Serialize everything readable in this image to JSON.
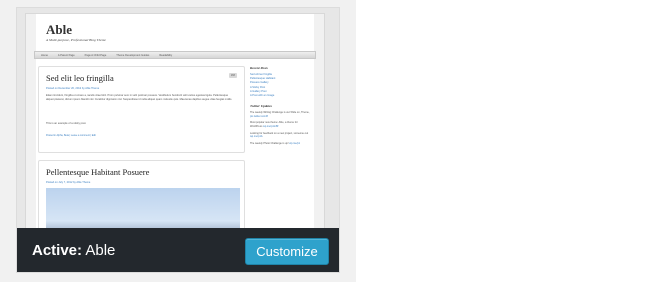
{
  "theme_preview": {
    "site_title": "Able",
    "tagline": "A Multi-purpose, Professional Blog Theme",
    "nav": [
      "Home",
      "A Parent Page",
      "Page A Child Page",
      "Theme Development Guides",
      "Readability"
    ],
    "posts": [
      {
        "title": "Sed elit leo fringilla",
        "meta": "Posted on December 20, 2012 by Able Theme",
        "badge": "###",
        "text": "Etiam tincidunt, fringilla et ornare a, iaculis vitae feliz. Proin pulvinar sem in velit pulvinar posuere. Vestibulum hendrerit velit varius egestas ligula. Pellentesque aliquet placerat, dictum ipsum blandit nisl. Curabitur dignissim nisl. Suspendisse id nulla aliquet quam molestie quis. Maecenas dapibus augue vitae feugiat mollis.",
        "text2": "This is an example of a sticky post.",
        "footer": "Posted in Alpha, Beta | Leave a comment | Edit"
      },
      {
        "title": "Pellentesque Habitant Posuere",
        "meta": "Posted on July 7, 2012 by Able Theme"
      }
    ],
    "sidebar": {
      "recent_posts_title": "Recent Posts",
      "recent_posts": [
        "Sed elit leo fringilla",
        "Pellentesque Habitant",
        "Posuere Gallery",
        "A Sticky Post",
        "A Gallery Post",
        "A Post with an Image"
      ],
      "twitter_title": "Twitter Updates",
      "tweets": [
        {
          "text": "The weekly Writing Challenge is out! Ride on, Theme,",
          "link": "pic.twitter.com/8"
        },
        {
          "text": "Most popular new theme: Able, a theme for WordPress",
          "link": "wp.me/p1mBf"
        },
        {
          "text": "Looking for feedback on a new project, someone out",
          "link": "wp.me/p1A"
        },
        {
          "text": "The weekly Photo Challenge is up!",
          "link": "wp.me/p1"
        }
      ]
    }
  },
  "status": {
    "active_prefix": "Active:",
    "theme_name": "Able",
    "customize_label": "Customize"
  }
}
